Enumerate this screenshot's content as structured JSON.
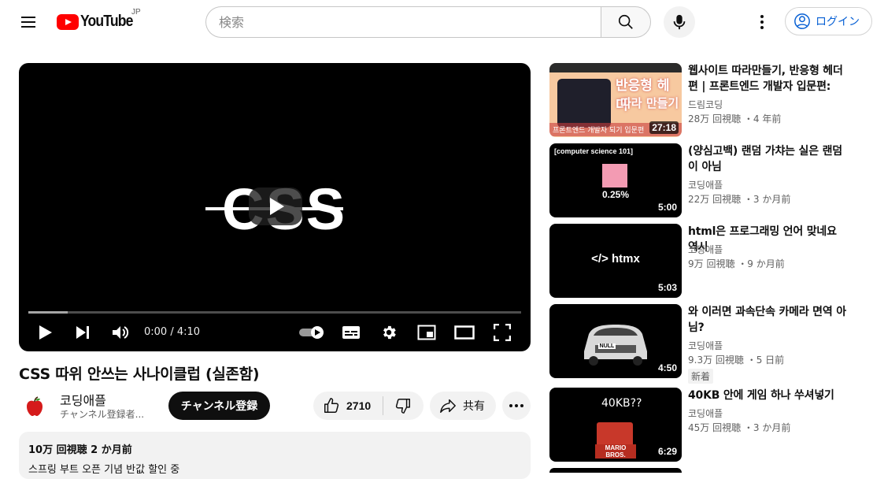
{
  "header": {
    "logo_text": "YouTube",
    "region": "JP",
    "search_placeholder": "検索",
    "login_label": "ログイン"
  },
  "player": {
    "overlay_text": "CSS",
    "time_display": "0:00 / 4:10",
    "progress": 0.08
  },
  "video": {
    "title": "CSS 따위 안쓰는 사나이클럽 (실존함)",
    "channel_name": "코딩애플",
    "channel_subs": "チャンネル登録者...",
    "subscribe_label": "チャンネル登録",
    "like_count": "2710",
    "share_label": "共有",
    "description_meta": "10万 回視聴  2 か月前",
    "description_text": "스프링 부트 오픈 기념 반값 할인 중"
  },
  "recommendations": [
    {
      "title": "웹사이트 따라만들기, 반응형 헤더편 | 프론트엔드 개발자 입문편: HTM...",
      "channel": "드림코딩",
      "meta": "28万 回視聴 ・4 年前",
      "duration": "27:18",
      "thumb_text_1": "반응형 헤더",
      "thumb_text_2": "따라 만들기",
      "thumb_text_3": "프론트엔드 개발자 되기 입문편"
    },
    {
      "title": "(양심고백) 랜덤 가챠는 실은 랜덤이 아님",
      "channel": "코딩애플",
      "meta": "22万 回視聴 ・3 か月前",
      "duration": "5:00",
      "thumb_text_1": "[computer science 101]",
      "thumb_text_2": "0.25%"
    },
    {
      "title": "html은 프로그래밍 언어 맞네요 역시",
      "channel": "코딩애플",
      "meta": "9万 回視聴 ・9 か月前",
      "duration": "5:03",
      "thumb_text_1": "</> htmx"
    },
    {
      "title": "와 이러면 과속단속 카메라 면역 아님?",
      "channel": "코딩애플",
      "meta": "9.3万 回視聴 ・5 日前",
      "duration": "4:50",
      "badge": "新着",
      "thumb_text_1": "NULL"
    },
    {
      "title": "40KB 안에 게임 하나 쑤셔넣기",
      "channel": "코딩애플",
      "meta": "45万 回視聴 ・3 か月前",
      "duration": "6:29",
      "thumb_text_1": "40KB??",
      "thumb_text_2": "MARIO BROS."
    }
  ],
  "colors": {
    "brand_red": "#ff0000",
    "link_blue": "#065fd4",
    "surface": "#f2f2f2"
  }
}
